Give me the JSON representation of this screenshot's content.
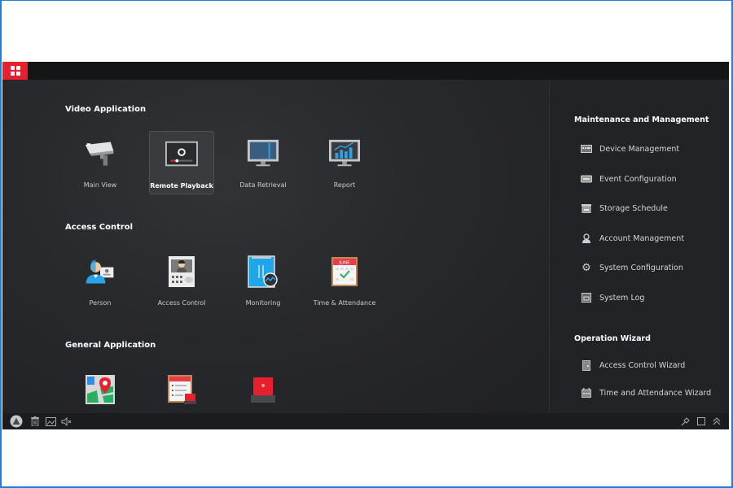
{
  "window": {
    "home_icon": "grid-icon"
  },
  "main": {
    "sections": [
      {
        "title": "Video Application",
        "items": [
          {
            "label": "Main View",
            "icon": "camera-icon",
            "active": false
          },
          {
            "label": "Remote Playback",
            "icon": "playback-icon",
            "active": true
          },
          {
            "label": "Data Retrieval",
            "icon": "monitor-retrieval-icon",
            "active": false
          },
          {
            "label": "Report",
            "icon": "report-chart-icon",
            "active": false
          }
        ]
      },
      {
        "title": "Access Control",
        "items": [
          {
            "label": "Person",
            "icon": "person-card-icon",
            "active": false
          },
          {
            "label": "Access Control",
            "icon": "door-terminal-icon",
            "active": false
          },
          {
            "label": "Monitoring",
            "icon": "door-monitor-icon",
            "active": false
          },
          {
            "label": "Time & Attendance",
            "icon": "calendar-check-icon",
            "active": false,
            "calendar_month": "JUNE"
          }
        ]
      },
      {
        "title": "General Application",
        "items": [
          {
            "label": "",
            "icon": "map-pin-icon",
            "active": false
          },
          {
            "label": "",
            "icon": "event-list-alarm-icon",
            "active": false
          },
          {
            "label": "",
            "icon": "alarm-light-icon",
            "active": false
          }
        ]
      }
    ]
  },
  "side": {
    "maintenance_title": "Maintenance and Management",
    "maintenance_items": [
      {
        "label": "Device Management",
        "icon": "device-icon"
      },
      {
        "label": "Event Configuration",
        "icon": "event-config-icon"
      },
      {
        "label": "Storage Schedule",
        "icon": "storage-icon"
      },
      {
        "label": "Account Management",
        "icon": "user-icon"
      },
      {
        "label": "System Configuration",
        "icon": "gear-icon"
      },
      {
        "label": "System Log",
        "icon": "log-icon"
      }
    ],
    "wizard_title": "Operation Wizard",
    "wizard_items": [
      {
        "label": "Access Control Wizard",
        "icon": "door-icon"
      },
      {
        "label": "Time and Attendance Wizard",
        "icon": "calendar-icon"
      }
    ]
  },
  "statusbar": {
    "left_icons": [
      "alert-icon",
      "trash-icon",
      "image-icon",
      "mute-icon"
    ],
    "right_icons": [
      "pin-icon",
      "maximize-icon",
      "collapse-up-icon"
    ]
  },
  "colors": {
    "brand_red": "#e8202e",
    "accent_blue": "#2aa4e8",
    "frame_blue": "#1e7fe0"
  }
}
